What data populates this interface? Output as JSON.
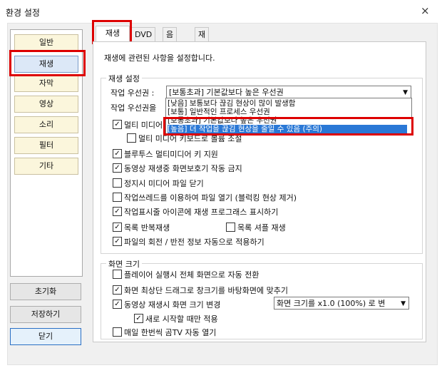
{
  "window": {
    "title": "환경 설정",
    "close": "×"
  },
  "sidebar": {
    "items": [
      "일반",
      "재생",
      "자막",
      "영상",
      "소리",
      "필터",
      "기타"
    ],
    "reset": "초기화",
    "save": "저장하기",
    "close": "닫기"
  },
  "tabs": [
    "재생",
    "DVD",
    "음악",
    "재생 이동 시간"
  ],
  "description": "재생에 관련된 사항을 설정합니다.",
  "playback": {
    "group_label": "재생 설정",
    "priority_label": "작업 우선권 :",
    "priority_value": "[보통초과] 기본값보다 높은 우선권",
    "priority2_label": "작업 우선권을",
    "options": [
      "[낮음] 보통보다 끊김 현상이 많이 발생함",
      "[보통] 일반적인 프로세스 우선권",
      "[보통초과] 기본값보다 높은 우선권",
      "[높음] 더 작업을 끊김 현상을 줄일 수 있음 (주의)"
    ],
    "multimedia_timer": "멀티 미디어",
    "multimedia_keys_label": "멀티 미디어 키보드로 볼륨 조절",
    "bluetooth_keys": "블루투스 멀티미디어 키 지원",
    "screensaver": "동영상 재생중 화면보호기 작동 금지",
    "close_file_on_stop": "정지시 미디어 파일 닫기",
    "worker_thread": "작업쓰레드를 이용하여 파일 열기 (블럭킹 현상 제거)",
    "taskbar_progress": "작업표시줄 아이콘에 재생 프로그래스 표시하기",
    "repeat_playlist": "목록 반복재생",
    "shuffle_playlist": "목록 셔플 재생",
    "rotation_info": "파일의 회전 / 반전 정보 자동으로 적용하기"
  },
  "screen": {
    "group_label": "화면 크기",
    "fullscreen_on_start": "플레이어 실행시 전체 화면으로 자동 전환",
    "drag_titlebar": "화면 최상단 드래그로 창크기를 바탕화면에 맞추기",
    "resize_on_play": "동영상 재생시 화면 크기 변경",
    "resize_value": "화면 크기를 x1.0 (100%) 로 변",
    "only_new_start": "새로 시작할 때만 적용",
    "gomtv_once": "매일 한번씩 곰TV 자동 열기"
  },
  "checks": {
    "multimedia_timer": "✓",
    "multimedia_keys": "",
    "bluetooth": "✓",
    "screensaver": "✓",
    "close_file": "",
    "worker_thread": "",
    "taskbar": "✓",
    "repeat": "✓",
    "shuffle": "",
    "rotation": "✓",
    "fullscreen": "",
    "drag": "✓",
    "resize": "✓",
    "new_start": "✓",
    "gomtv": ""
  },
  "colors": {
    "highlight": "#2a78d6",
    "annotation": "#dd0000",
    "nav_bg": "#fbf6dc"
  }
}
